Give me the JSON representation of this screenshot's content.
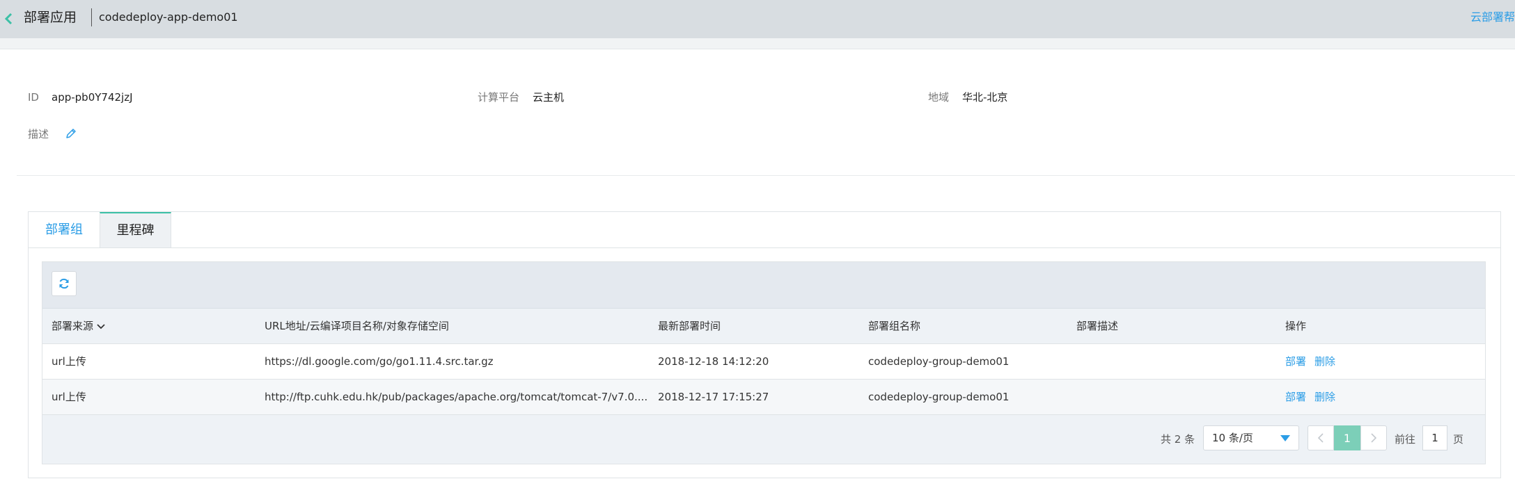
{
  "header": {
    "title": "部署应用",
    "app_name": "codedeploy-app-demo01",
    "help_link": "云部署帮助"
  },
  "info": {
    "id_label": "ID",
    "id_value": "app-pb0Y742jzJ",
    "platform_label": "计算平台",
    "platform_value": "云主机",
    "region_label": "地域",
    "region_value": "华北-北京",
    "desc_label": "描述"
  },
  "tabs": [
    {
      "label": "部署组",
      "active": false
    },
    {
      "label": "里程碑",
      "active": true
    }
  ],
  "table": {
    "columns": [
      "部署来源",
      "URL地址/云编译项目名称/对象存储空间",
      "最新部署时间",
      "部署组名称",
      "部署描述",
      "操作"
    ],
    "rows": [
      {
        "source": "url上传",
        "url": "https://dl.google.com/go/go1.11.4.src.tar.gz",
        "time": "2018-12-18 14:12:20",
        "group": "codedeploy-group-demo01",
        "desc": "",
        "actions": [
          "部署",
          "删除"
        ]
      },
      {
        "source": "url上传",
        "url": "http://ftp.cuhk.edu.hk/pub/packages/apache.org/tomcat/tomcat-7/v7.0....",
        "time": "2018-12-17 17:15:27",
        "group": "codedeploy-group-demo01",
        "desc": "",
        "actions": [
          "部署",
          "删除"
        ]
      }
    ]
  },
  "pagination": {
    "total": "共 2 条",
    "page_size": "10 条/页",
    "current_page": "1",
    "goto_label": "前往",
    "goto_value": "1",
    "goto_suffix": "页"
  },
  "icons": {
    "back": "chevron-left-icon",
    "edit": "pencil-icon",
    "refresh": "refresh-icon",
    "sort": "chevron-down-icon",
    "select": "caret-down-icon"
  },
  "colors": {
    "accent": "#2b9de6",
    "active_page": "#7ccfb8",
    "tab_indicator": "#3cc0a6",
    "header_bg": "#d8dde1"
  }
}
